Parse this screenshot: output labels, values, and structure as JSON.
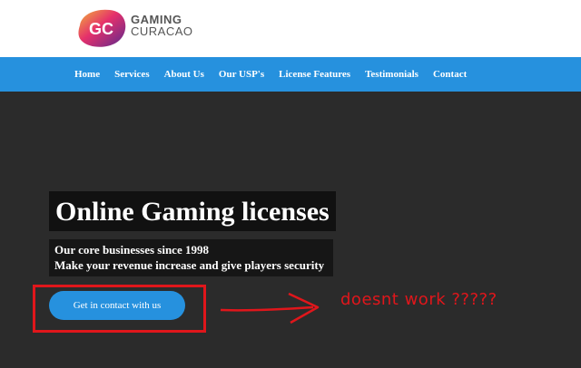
{
  "logo": {
    "monogram": "GC",
    "line1": "GAMING",
    "line2": "CURACAO"
  },
  "nav": {
    "items": [
      "Home",
      "Services",
      "About Us",
      "Our USP's",
      "License Features",
      "Testimonials",
      "Contact"
    ]
  },
  "hero": {
    "headline": "Online Gaming licenses",
    "sub1": "Our core businesses since 1998",
    "sub2": "Make your revenue increase and give players security",
    "cta_label": "Get in contact with us"
  },
  "annotation": {
    "note": "doesnt work ?????"
  },
  "colors": {
    "nav_blue": "#2691de",
    "hero_bg": "#2b2b2b",
    "annotation_red": "#e0161b"
  }
}
